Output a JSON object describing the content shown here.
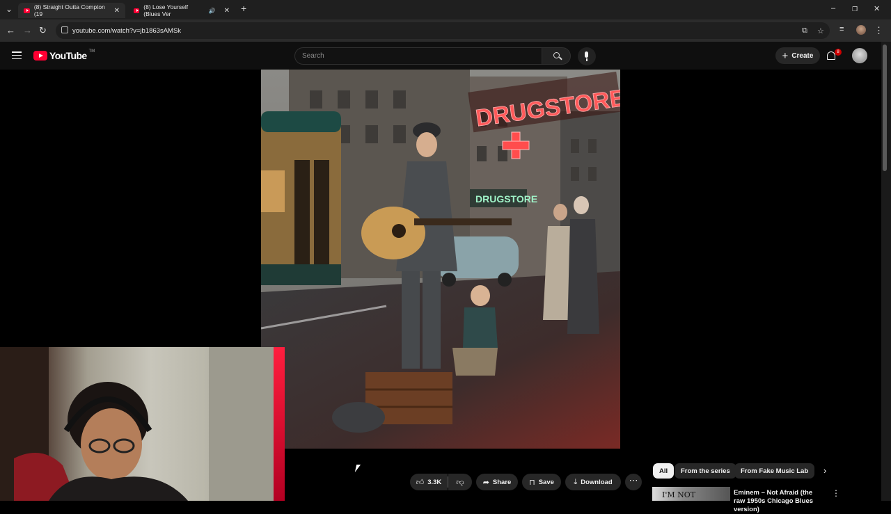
{
  "browser": {
    "tabs": [
      {
        "title": "(8) Straight Outta Compton (19",
        "active": true
      },
      {
        "title": "(8) Lose Yourself (Blues Ver",
        "active": false
      }
    ],
    "url": "youtube.com/watch?v=jb1863sAMSk",
    "icons": [
      "tab-search-icon",
      "back-icon",
      "forward-icon",
      "reload-icon",
      "site-info-icon",
      "install-icon",
      "bookmark-star-icon",
      "reading-list-icon",
      "profile-icon",
      "menu-kebab-icon",
      "minimize-icon",
      "restore-icon",
      "close-icon",
      "new-tab-plus-icon",
      "audio-playing-icon"
    ]
  },
  "youtube": {
    "logo_text": "YouTube",
    "logo_tm": "TM",
    "search_placeholder": "Search",
    "create_label": "Create",
    "notification_count": "8",
    "brand_color": "#ff0033",
    "background": "#0f0f0f"
  },
  "video_actions": {
    "likes": "3.3K",
    "share_label": "Share",
    "save_label": "Save",
    "download_label": "Download"
  },
  "scene_signs": {
    "neon_sign": "DRUGSTORE",
    "storefront_sign": "DRUGSTORE"
  },
  "related": {
    "chips": [
      {
        "label": "All",
        "selected": true
      },
      {
        "label": "From the series",
        "selected": false
      },
      {
        "label": "From Fake Music Lab",
        "selected": false
      }
    ],
    "first_item": {
      "thumb_text": "I'M NOT",
      "title": "Eminem – Not Afraid (the raw 1950s Chicago Blues version)"
    }
  }
}
